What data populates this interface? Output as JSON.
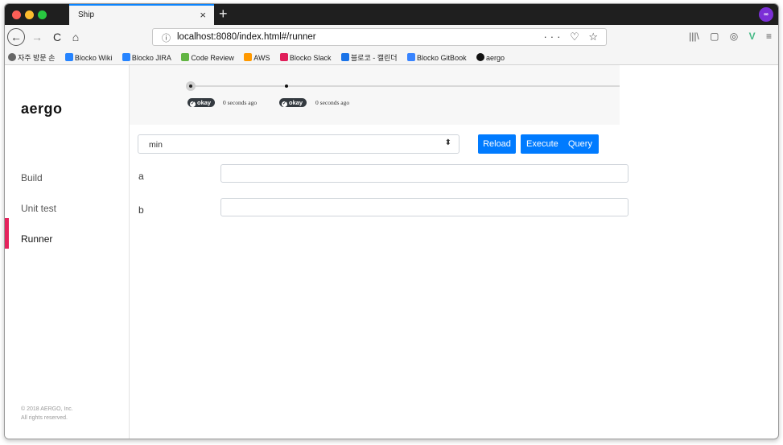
{
  "browser": {
    "tab_title": "Ship",
    "close_glyph": "×",
    "new_tab_glyph": "+",
    "back_glyph": "←",
    "forward_glyph": "→",
    "reload_glyph": "C",
    "home_glyph": "⌂",
    "info_glyph": "ⓘ",
    "url": "localhost:8080/index.html#/runner",
    "url_actions": "··· ♡ ☆",
    "toolbar_icons": [
      "library-icon",
      "sidebar-icon",
      "extension-icon",
      "vue-devtools-icon",
      "menu-icon"
    ],
    "toolbar_glyphs": [
      "|||\\",
      "▢",
      "◎",
      "V",
      "≡"
    ]
  },
  "bookmarks": [
    {
      "label": "자주 방문 손",
      "icon": "gear-icon",
      "color": "#666666"
    },
    {
      "label": "Blocko Wiki",
      "icon": "confluence-icon",
      "color": "#2684ff"
    },
    {
      "label": "Blocko JIRA",
      "icon": "jira-icon",
      "color": "#2684ff"
    },
    {
      "label": "Code Review",
      "icon": "code-review-icon",
      "color": "#62b543"
    },
    {
      "label": "AWS",
      "icon": "aws-icon",
      "color": "#ff9900"
    },
    {
      "label": "Blocko Slack",
      "icon": "slack-icon",
      "color": "#e01e5a"
    },
    {
      "label": "블로코 - 캘린더",
      "icon": "calendar-icon",
      "color": "#1a73e8"
    },
    {
      "label": "Blocko GitBook",
      "icon": "gitbook-icon",
      "color": "#3884ff"
    },
    {
      "label": "aergo",
      "icon": "github-icon",
      "color": "#111111"
    }
  ],
  "sidebar": {
    "logo": "aergo",
    "items": [
      {
        "label": "Build"
      },
      {
        "label": "Unit test"
      },
      {
        "label": "Runner"
      }
    ],
    "active_index": 2,
    "footer_line1": "© 2018 AERGO, Inc.",
    "footer_line2": "All rights reserved."
  },
  "timeline": {
    "events": [
      {
        "status": "okay",
        "time": "0 seconds ago"
      },
      {
        "status": "okay",
        "time": "0 seconds ago"
      }
    ]
  },
  "runner": {
    "function_select": "min",
    "select_arrow": "⬍",
    "buttons": {
      "reload": "Reload",
      "execute": "Execute",
      "query": "Query"
    },
    "params": [
      {
        "label": "a",
        "value": ""
      },
      {
        "label": "b",
        "value": ""
      }
    ]
  },
  "colors": {
    "accent": "#007bff",
    "active_bar": "#e5235d",
    "pill": "#343a40"
  }
}
